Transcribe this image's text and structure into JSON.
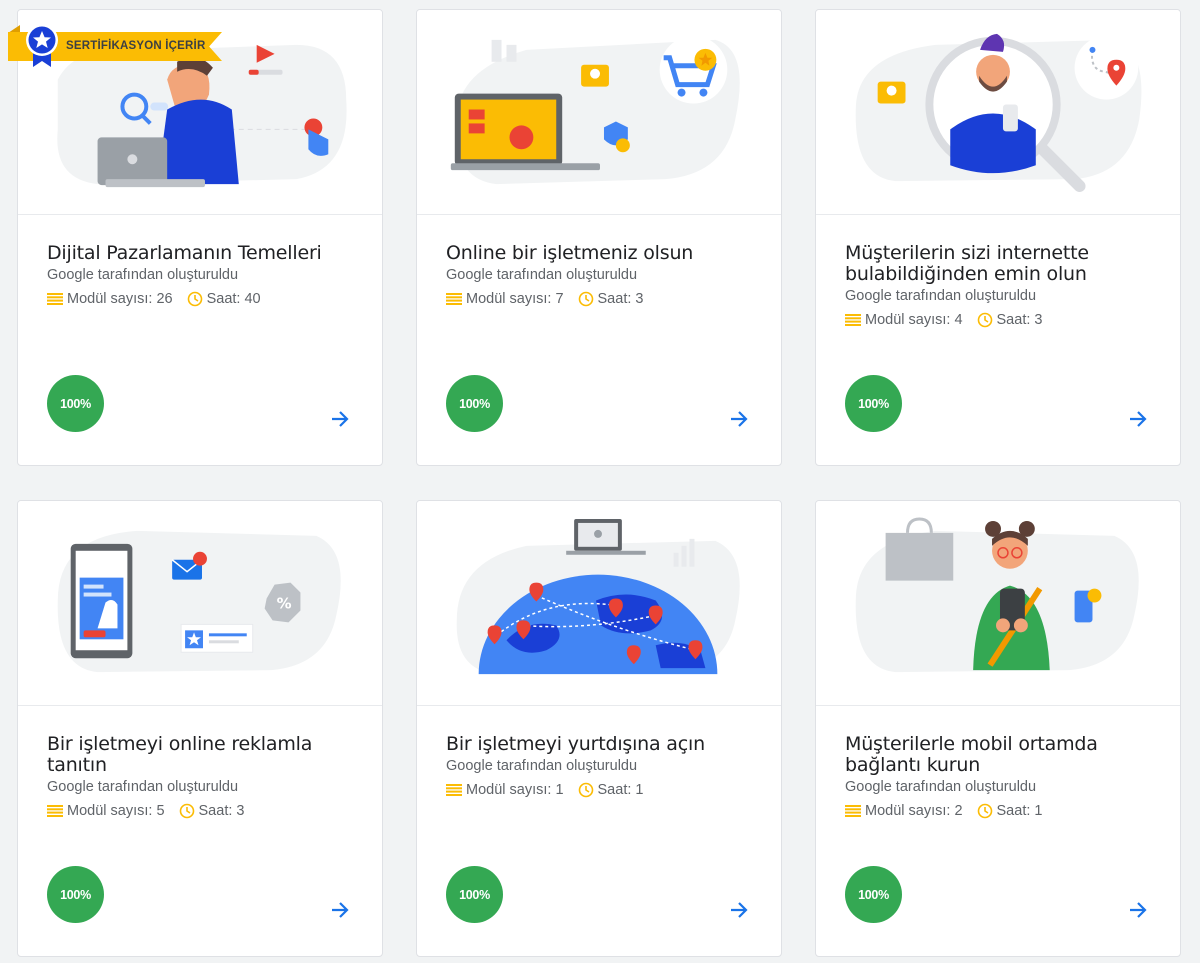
{
  "badge": {
    "label": "SERTİFİKASYON İÇERİR"
  },
  "colors": {
    "progress": "#34a853",
    "arrow": "#1a73e8",
    "meta_icon": "#fbbc04",
    "badge": "#fbbc04"
  },
  "courses": [
    {
      "title": "Dijital Pazarlamanın Temelleri",
      "author": "Google tarafından oluşturuldu",
      "modules": "Modül sayısı: 26",
      "hours": "Saat: 40",
      "progress": "100%",
      "illustration": "person-laptop-search"
    },
    {
      "title": "Online bir işletmeniz olsun",
      "author": "Google tarafından oluşturuldu",
      "modules": "Modül sayısı: 7",
      "hours": "Saat: 3",
      "progress": "100%",
      "illustration": "laptop-shopping-cart"
    },
    {
      "title": "Müşterilerin sizi internette bulabildiğinden emin olun",
      "author": "Google tarafından oluşturuldu",
      "modules": "Modül sayısı: 4",
      "hours": "Saat: 3",
      "progress": "100%",
      "illustration": "magnifier-person-map"
    },
    {
      "title": "Bir işletmeyi online reklamla tanıtın",
      "author": "Google tarafından oluşturuldu",
      "modules": "Modül sayısı: 5",
      "hours": "Saat: 3",
      "progress": "100%",
      "illustration": "tablet-ad-discount"
    },
    {
      "title": "Bir işletmeyi yurtdışına açın",
      "author": "Google tarafından oluşturuldu",
      "modules": "Modül sayısı: 1",
      "hours": "Saat: 1",
      "progress": "100%",
      "illustration": "globe-pins"
    },
    {
      "title": "Müşterilerle mobil ortamda bağlantı kurun",
      "author": "Google tarafından oluşturuldu",
      "modules": "Modül sayısı: 2",
      "hours": "Saat: 1",
      "progress": "100%",
      "illustration": "woman-phone-shopping"
    }
  ]
}
